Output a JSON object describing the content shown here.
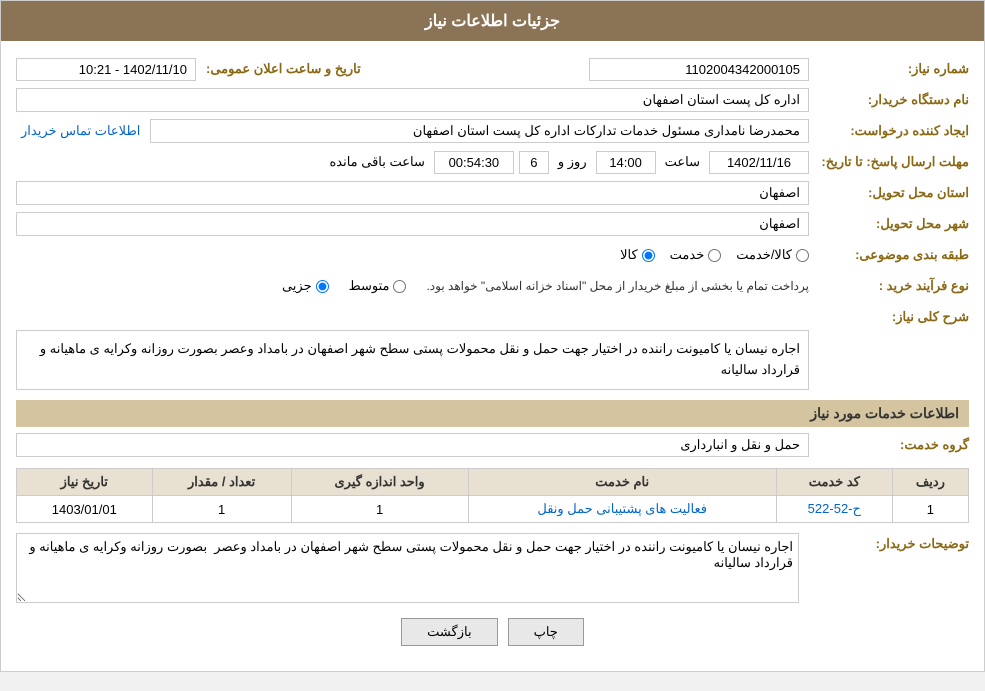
{
  "header": {
    "title": "جزئیات اطلاعات نیاز"
  },
  "fields": {
    "need_number_label": "شماره نیاز:",
    "need_number_value": "1102004342000105",
    "buyer_org_label": "نام دستگاه خریدار:",
    "buyer_org_value": "اداره کل پست استان اصفهان",
    "created_by_label": "ایجاد کننده درخواست:",
    "created_by_value": "محمدرضا نامداری مسئول خدمات تدارکات اداره کل پست استان اصفهان",
    "contact_link": "اطلاعات تماس خریدار",
    "announcement_label": "تاریخ و ساعت اعلان عمومی:",
    "announcement_value": "1402/11/10 - 10:21",
    "reply_deadline_label": "مهلت ارسال پاسخ: تا تاریخ:",
    "reply_date": "1402/11/16",
    "reply_time": "14:00",
    "reply_days": "6",
    "reply_remaining": "00:54:30",
    "reply_day_label": "روز و",
    "reply_hour_label": "ساعت",
    "reply_remaining_label": "ساعت باقی مانده",
    "province_label": "استان محل تحویل:",
    "province_value": "اصفهان",
    "city_label": "شهر محل تحویل:",
    "city_value": "اصفهان",
    "subject_label": "طبقه بندی موضوعی:",
    "subject_kala": "کالا",
    "subject_khedmat": "خدمت",
    "subject_kala_khedmat": "کالا/خدمت",
    "process_label": "نوع فرآیند خرید :",
    "process_jozyi": "جزیی",
    "process_motawaset": "متوسط",
    "process_note": "پرداخت تمام یا بخشی از مبلغ خریدار از محل \"اسناد خزانه اسلامی\" خواهد بود.",
    "description_label": "شرح کلی نیاز:",
    "description_value": "اجاره نیسان یا کامیونت راننده در اختیار جهت حمل و نقل محمولات پستی سطح شهر اصفهان در بامداد وعصر بصورت روزانه وکرایه ی ماهیانه و قرارداد سالیانه",
    "services_section": "اطلاعات خدمات مورد نیاز",
    "service_group_label": "گروه خدمت:",
    "service_group_value": "حمل و نقل و انبارداری",
    "table": {
      "col1": "ردیف",
      "col2": "کد خدمت",
      "col3": "نام خدمت",
      "col4": "واحد اندازه گیری",
      "col5": "تعداد / مقدار",
      "col6": "تاریخ نیاز",
      "rows": [
        {
          "row_num": "1",
          "service_code": "ح-52-522",
          "service_name": "فعالیت های پشتیبانی حمل ونقل",
          "unit": "1",
          "quantity": "1",
          "date": "1403/01/01"
        }
      ]
    },
    "buyer_desc_label": "توضیحات خریدار:",
    "buyer_desc_value": "اجاره نیسان یا کامیونت راننده در اختیار جهت حمل و نقل محمولات پستی سطح شهر اصفهان در بامداد وعصر  بصورت روزانه وکرایه ی ماهیانه و قرارداد سالیانه",
    "btn_print": "چاپ",
    "btn_back": "بازگشت"
  }
}
